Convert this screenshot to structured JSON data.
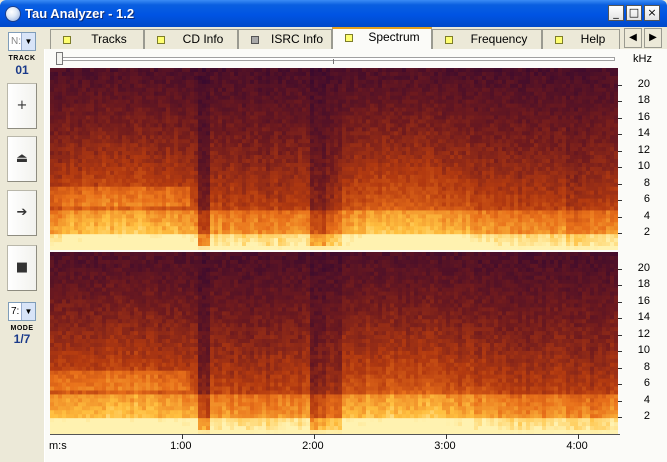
{
  "window": {
    "title": "Tau Analyzer - 1.2",
    "controls": {
      "minimize": "_",
      "maximize": "□",
      "close": "×"
    },
    "titlebar_color": "#0054e3"
  },
  "left_panel": {
    "track_combo": "N:",
    "track_caption": "TRACK",
    "track_number": "01",
    "buttons": [
      {
        "name": "zoom-in-button",
        "glyph": "+",
        "icon": "plus-icon"
      },
      {
        "name": "eject-button",
        "glyph": "⏏",
        "icon": "eject-icon"
      },
      {
        "name": "play-button",
        "glyph": "➔",
        "icon": "play-arrow-icon"
      },
      {
        "name": "stop-button",
        "glyph": "■",
        "icon": "stop-icon"
      }
    ],
    "mode_combo": "7:",
    "mode_caption": "MODE",
    "mode_value": "1/7"
  },
  "tabs": [
    {
      "label": "Tracks",
      "led": "yellow"
    },
    {
      "label": "CD Info",
      "led": "yellow"
    },
    {
      "label": "ISRC Info",
      "led": "grey"
    },
    {
      "label": "Spectrum",
      "led": "yellow",
      "active": true
    },
    {
      "label": "Frequency",
      "led": "yellow"
    },
    {
      "label": "Help",
      "led": "yellow"
    }
  ],
  "tab_scroll": {
    "left": "◀",
    "right": "▶"
  },
  "spectrum": {
    "unit": "kHz",
    "y_ticks": [
      "20",
      "18",
      "16",
      "14",
      "12",
      "10",
      "8",
      "6",
      "4",
      "2"
    ],
    "x_axis_label": "m:s",
    "x_ticks": [
      "1:00",
      "2:00",
      "3:00",
      "4:00"
    ],
    "channels": 2,
    "colormap": [
      "#3a0a2e",
      "#6e1a1e",
      "#b33a10",
      "#e8701a",
      "#ffc040",
      "#fff2b0"
    ]
  },
  "chart_data": {
    "type": "heatmap",
    "ylabel": "kHz",
    "xlabel": "m:s",
    "yticks": [
      2,
      4,
      6,
      8,
      10,
      12,
      14,
      16,
      18,
      20
    ],
    "xticks": [
      "1:00",
      "2:00",
      "3:00",
      "4:00"
    ],
    "xlim_seconds": [
      0,
      258
    ],
    "ylim_khz": [
      0,
      22
    ]
  }
}
